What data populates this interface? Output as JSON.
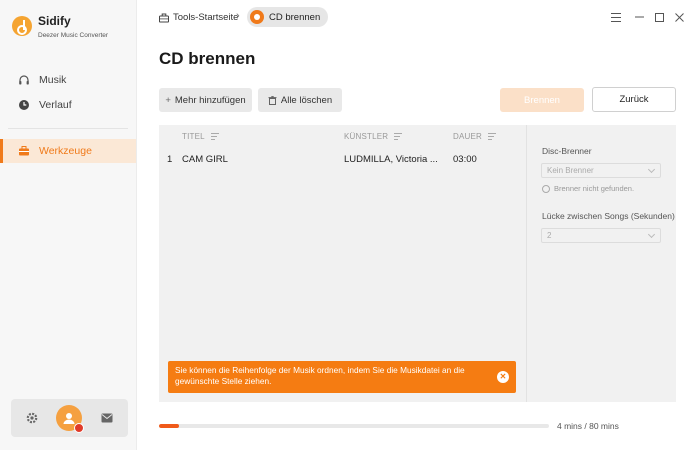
{
  "app": {
    "name": "Sidify",
    "subtitle": "Deezer Music Converter"
  },
  "sidebar": {
    "items": [
      {
        "label": "Musik",
        "icon": "headphones-icon"
      },
      {
        "label": "Verlauf",
        "icon": "clock-icon"
      },
      {
        "label": "Werkzeuge",
        "icon": "toolbox-icon",
        "active": true
      }
    ]
  },
  "breadcrumb": {
    "home": "Tools-Startseite",
    "separator": "›",
    "current": "CD brennen"
  },
  "page": {
    "title": "CD brennen"
  },
  "toolbar": {
    "add_label": "Mehr hinzufügen",
    "clear_label": "Alle löschen",
    "burn_label": "Brennen",
    "back_label": "Zurück"
  },
  "table": {
    "columns": [
      "TITEL",
      "KÜNSTLER",
      "DAUER"
    ],
    "rows": [
      {
        "index": "1",
        "title": "CAM GIRL",
        "artist": "LUDMILLA, Victoria ...",
        "duration": "03:00"
      }
    ]
  },
  "settings": {
    "burner_label": "Disc-Brenner",
    "burner_value": "Kein Brenner",
    "burner_note": "Brenner nicht gefunden.",
    "gap_label": "Lücke zwischen Songs (Sekunden)",
    "gap_value": "2"
  },
  "toast": {
    "message": "Sie können die Reihenfolge der Musik ordnen, indem Sie die Musikdatei an die gewünschte Stelle ziehen.",
    "close": "✕"
  },
  "progress": {
    "used_minutes": 4,
    "total_minutes": 80,
    "label": "4 mins / 80 mins"
  },
  "colors": {
    "accent": "#f07a1a",
    "toast": "#f57c12",
    "burn_disabled": "#fbe0c8"
  }
}
